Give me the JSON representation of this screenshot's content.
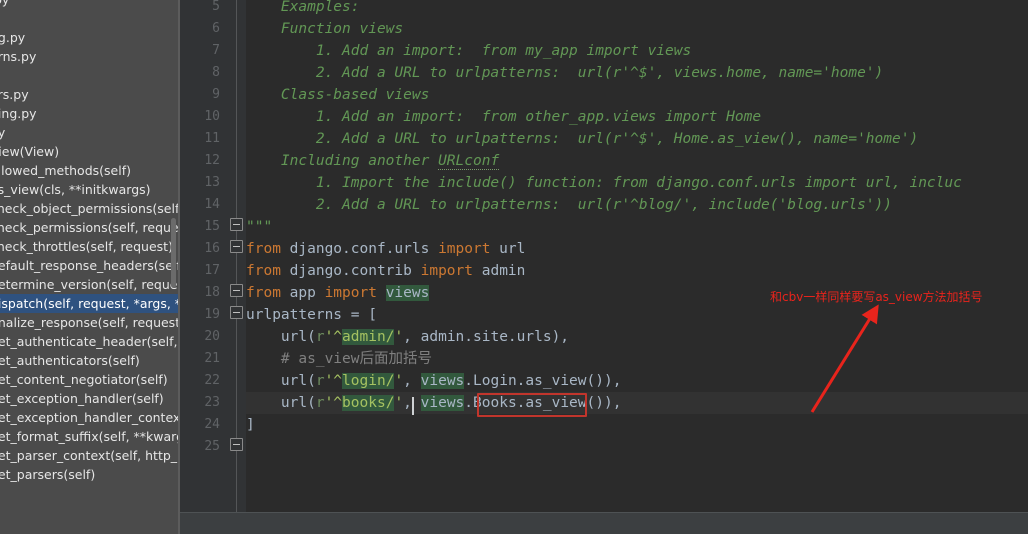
{
  "sidebar": {
    "name": "structure-popup",
    "items": [
      {
        "label": ".py",
        "selected": false
      },
      {
        "label": "",
        "selected": false
      },
      {
        "label": "ng.py",
        "selected": false
      },
      {
        "label": "erns.py",
        "selected": false
      },
      {
        "label": "",
        "selected": false
      },
      {
        "label": "ors.py",
        "selected": false
      },
      {
        "label": "ning.py",
        "selected": false
      },
      {
        "label": "py",
        "selected": false
      },
      {
        "label": "View(View)",
        "selected": false
      },
      {
        "label": "allowed_methods(self)",
        "selected": false
      },
      {
        "label": "as_view(cls, **initkwargs)",
        "selected": false
      },
      {
        "label": "check_object_permissions(self,",
        "selected": false
      },
      {
        "label": "check_permissions(self, reques",
        "selected": false
      },
      {
        "label": "check_throttles(self, request)",
        "selected": false
      },
      {
        "label": "default_response_headers(self)",
        "selected": false
      },
      {
        "label": "determine_version(self, request",
        "selected": false
      },
      {
        "label": "dispatch(self, request, *args, **",
        "selected": true
      },
      {
        "label": "finalize_response(self, request,",
        "selected": false
      },
      {
        "label": "get_authenticate_header(self, re",
        "selected": false
      },
      {
        "label": "get_authenticators(self)",
        "selected": false
      },
      {
        "label": "get_content_negotiator(self)",
        "selected": false
      },
      {
        "label": "get_exception_handler(self)",
        "selected": false
      },
      {
        "label": "get_exception_handler_context(",
        "selected": false
      },
      {
        "label": "get_format_suffix(self, **kwargs",
        "selected": false
      },
      {
        "label": "get_parser_context(self, http_re",
        "selected": false
      },
      {
        "label": "get_parsers(self)",
        "selected": false
      }
    ]
  },
  "editor": {
    "name": "python-code-editor",
    "file_language": "Python",
    "first_visible_line": 5,
    "line_numbers": [
      5,
      6,
      7,
      8,
      9,
      10,
      11,
      12,
      13,
      14,
      15,
      16,
      17,
      18,
      19,
      20,
      21,
      22,
      23,
      24,
      25
    ],
    "caret": {
      "line": 23,
      "column_text": "vi|ews"
    },
    "lines": [
      {
        "no": 5,
        "text": "    Examples:"
      },
      {
        "no": 6,
        "text": "    Function views"
      },
      {
        "no": 7,
        "text": "        1. Add an import:  from my_app import views"
      },
      {
        "no": 8,
        "text": "        2. Add a URL to urlpatterns:  url(r'^$', views.home, name='home')"
      },
      {
        "no": 9,
        "text": "    Class-based views"
      },
      {
        "no": 10,
        "text": "        1. Add an import:  from other_app.views import Home"
      },
      {
        "no": 11,
        "text": "        2. Add a URL to urlpatterns:  url(r'^$', Home.as_view(), name='home')"
      },
      {
        "no": 12,
        "text": "    Including another URLconf"
      },
      {
        "no": 13,
        "text": "        1. Import the include() function: from django.conf.urls import url, incluc"
      },
      {
        "no": 14,
        "text": "        2. Add a URL to urlpatterns:  url(r'^blog/', include('blog.urls'))"
      },
      {
        "no": 15,
        "text": "\"\"\""
      },
      {
        "no": 16,
        "text": "from django.conf.urls import url"
      },
      {
        "no": 17,
        "text": "from django.contrib import admin"
      },
      {
        "no": 18,
        "text": "from app import views"
      },
      {
        "no": 19,
        "text": "urlpatterns = ["
      },
      {
        "no": 20,
        "text": "    url(r'^admin/', admin.site.urls),"
      },
      {
        "no": 21,
        "text": "    # as_view后面加括号"
      },
      {
        "no": 22,
        "text": "    url(r'^login/', views.Login.as_view()),"
      },
      {
        "no": 23,
        "text": "    url(r'^books/', views.Books.as_view()),"
      },
      {
        "no": 24,
        "text": "]"
      },
      {
        "no": 25,
        "text": ""
      }
    ]
  },
  "annotation": {
    "name": "red-marker-annotation",
    "text": "和cbv一样同样要写as_view方法加括号",
    "color": "#e8241c",
    "box_target": "as_view()),",
    "box_color": "#c1352c"
  },
  "colors": {
    "editor_background": "#2b2b2b",
    "gutter_background": "#313335",
    "sidebar_background": "#4b4b4b",
    "sidebar_selection": "#2f5280",
    "docstring_green": "#629755",
    "keyword_orange": "#cc7832",
    "string_green": "#a5c261",
    "identifier": "#a9b7c6",
    "comment_gray": "#808080",
    "occurrence_highlight": "#32593d",
    "line_number": "#606366"
  }
}
